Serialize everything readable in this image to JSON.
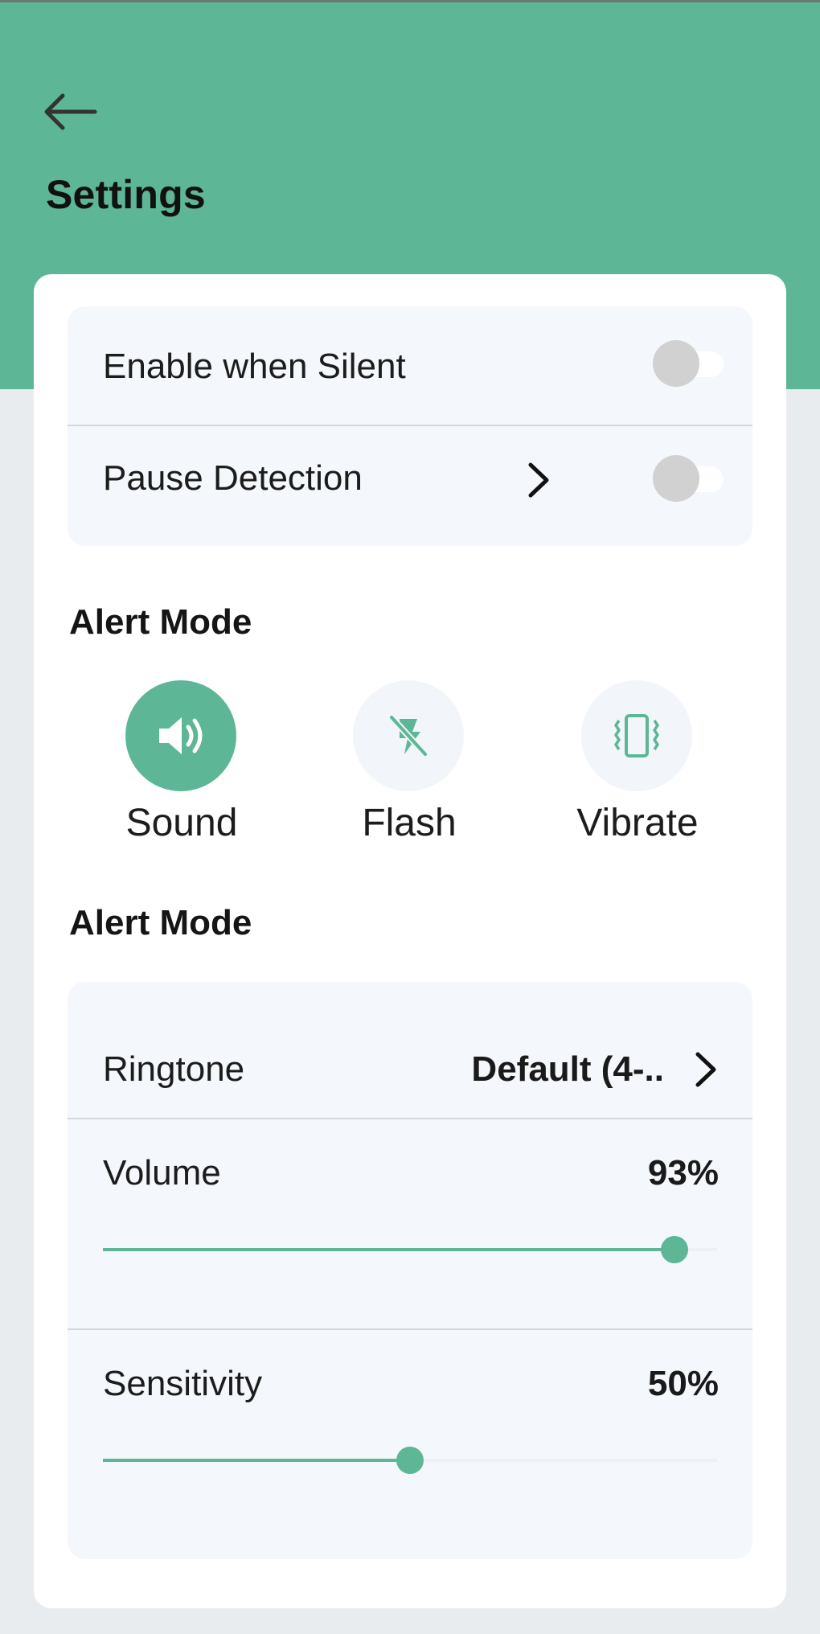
{
  "colors": {
    "accent": "#5db796",
    "background": "#e9ecef",
    "group_bg": "#f4f7fb"
  },
  "header": {
    "back_icon": "arrow-left-icon",
    "title": "Settings"
  },
  "toggles": {
    "enable_when_silent": {
      "label": "Enable when Silent",
      "on": false
    },
    "pause_detection": {
      "label": "Pause Detection",
      "on": false,
      "chevron_icon": "chevron-right-icon"
    }
  },
  "alert_mode": {
    "title": "Alert Mode",
    "options": [
      {
        "label": "Sound",
        "icon": "speaker-icon",
        "selected": true
      },
      {
        "label": "Flash",
        "icon": "flash-off-icon",
        "selected": false
      },
      {
        "label": "Vibrate",
        "icon": "vibrate-icon",
        "selected": false
      }
    ]
  },
  "alert_settings": {
    "title": "Alert Mode",
    "ringtone": {
      "label": "Ringtone",
      "value": "Default (4-..",
      "chevron_icon": "chevron-right-icon"
    },
    "volume": {
      "label": "Volume",
      "value_text": "93%",
      "value": 93
    },
    "sensitivity": {
      "label": "Sensitivity",
      "value_text": "50%",
      "value": 50
    }
  }
}
